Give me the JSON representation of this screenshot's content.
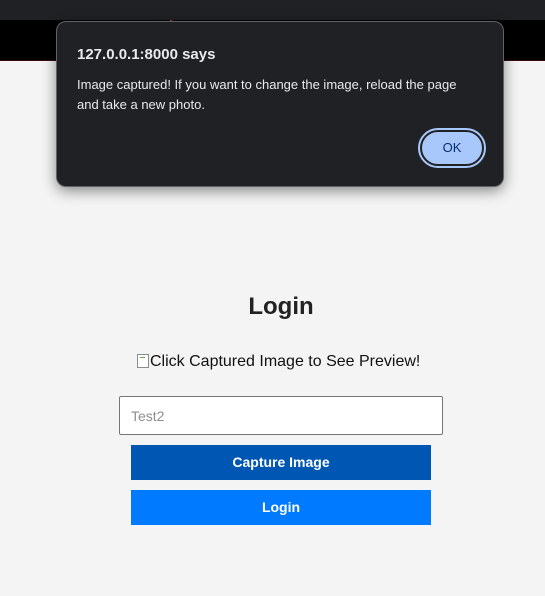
{
  "dialog": {
    "title": "127.0.0.1:8000 says",
    "message": "Image captured! If you want to change the image, reload the page and take a new photo.",
    "ok_label": "OK"
  },
  "login": {
    "title": "Login",
    "preview_alt": "Click Captured Image to See Preview!",
    "name_placeholder": "Test2",
    "capture_label": "Capture Image",
    "login_label": "Login"
  },
  "colors": {
    "page_background": "#f4f4f4",
    "header_background": "#000000",
    "capture_button": "#0056b3",
    "login_button": "#007bff",
    "dialog_background": "#202124",
    "ok_button": "#a8c7fa"
  }
}
